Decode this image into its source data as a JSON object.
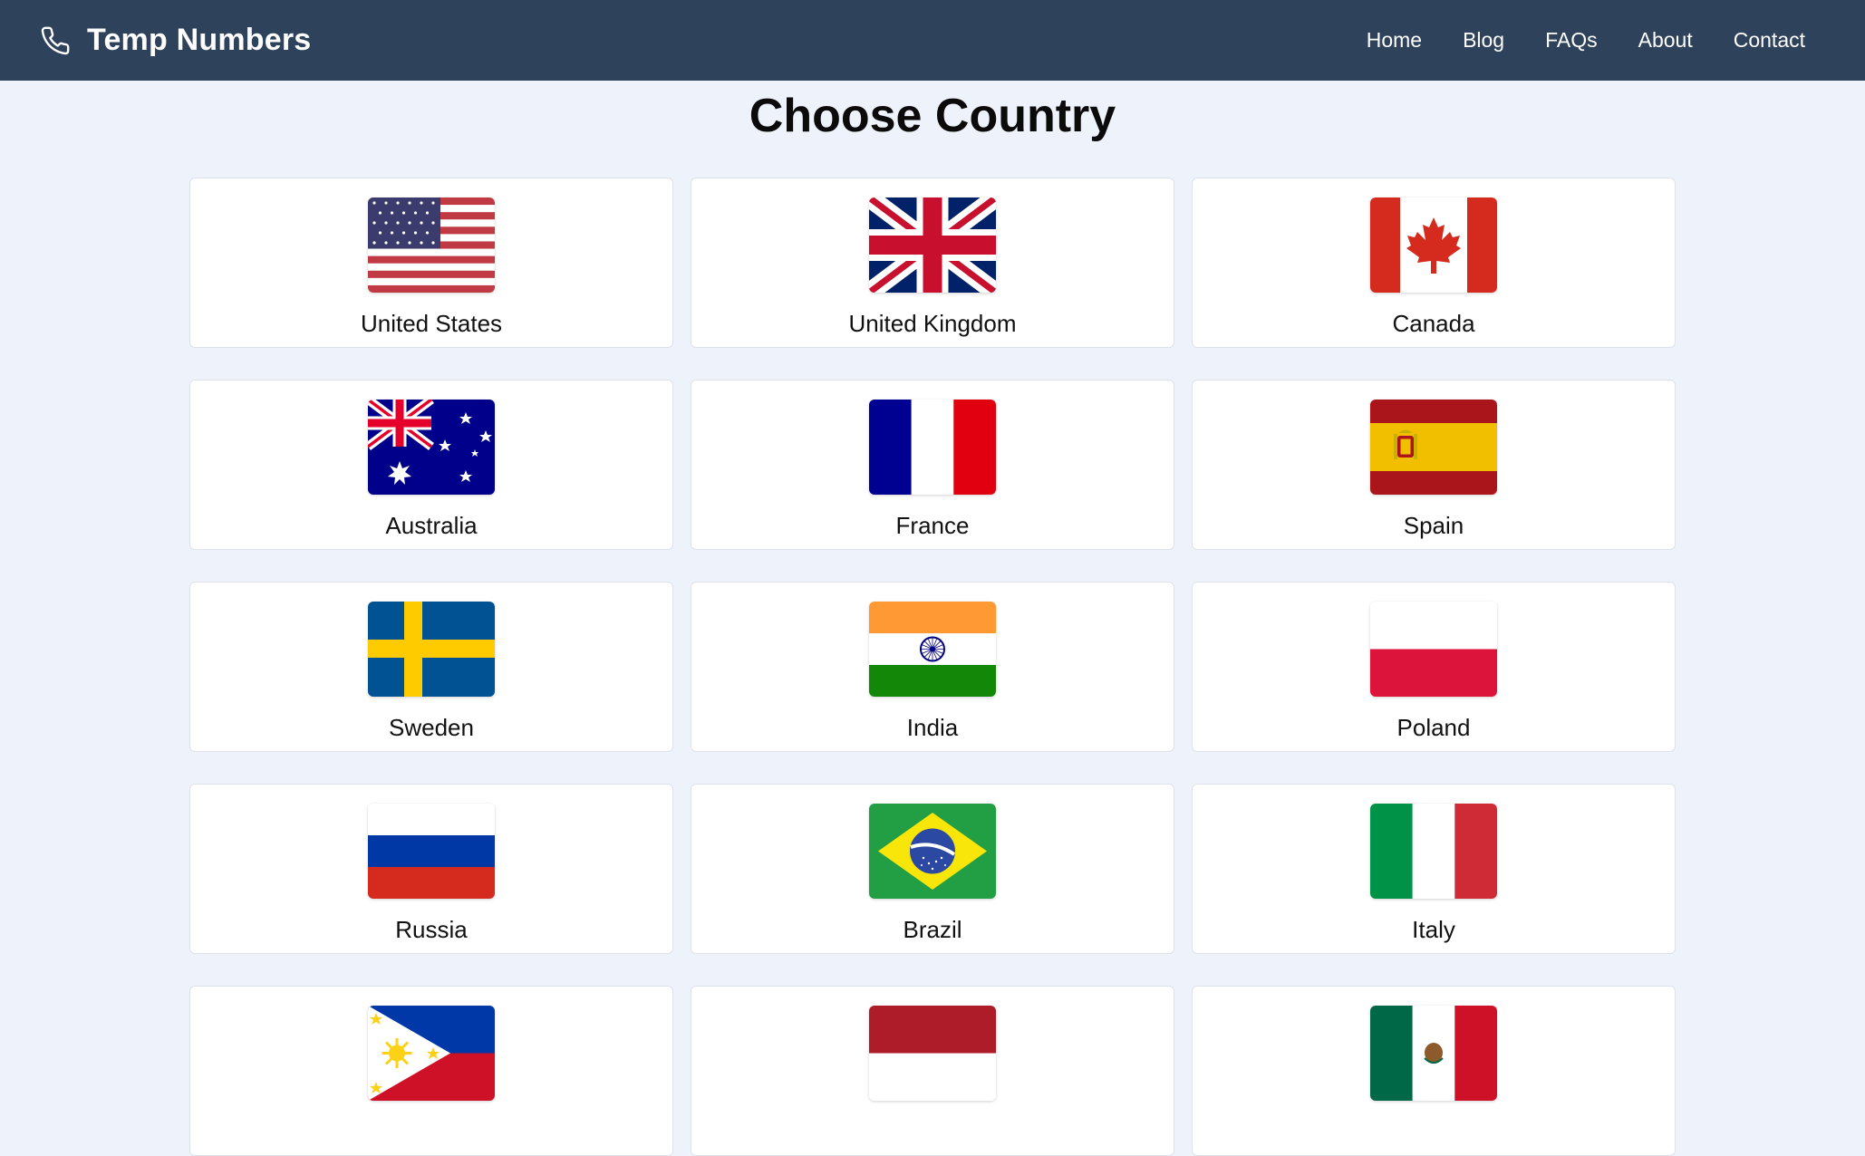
{
  "header": {
    "brand": "Temp Numbers",
    "nav": [
      "Home",
      "Blog",
      "FAQs",
      "About",
      "Contact"
    ]
  },
  "main": {
    "title": "Choose Country",
    "countries": [
      {
        "name": "United States",
        "flag": "us-flag-icon"
      },
      {
        "name": "United Kingdom",
        "flag": "uk-flag-icon"
      },
      {
        "name": "Canada",
        "flag": "canada-flag-icon"
      },
      {
        "name": "Australia",
        "flag": "australia-flag-icon"
      },
      {
        "name": "France",
        "flag": "france-flag-icon"
      },
      {
        "name": "Spain",
        "flag": "spain-flag-icon"
      },
      {
        "name": "Sweden",
        "flag": "sweden-flag-icon"
      },
      {
        "name": "India",
        "flag": "india-flag-icon"
      },
      {
        "name": "Poland",
        "flag": "poland-flag-icon"
      },
      {
        "name": "Russia",
        "flag": "russia-flag-icon"
      },
      {
        "name": "Brazil",
        "flag": "brazil-flag-icon"
      },
      {
        "name": "Italy",
        "flag": "italy-flag-icon"
      },
      {
        "name": "",
        "flag": "philippines-flag-icon"
      },
      {
        "name": "",
        "flag": "indonesia-flag-icon"
      },
      {
        "name": "",
        "flag": "mexico-flag-icon"
      }
    ]
  },
  "colors": {
    "header_bg": "#2e425c",
    "page_bg": "#eef2fb",
    "card_bg": "#ffffff",
    "card_border": "#dde2ea"
  }
}
